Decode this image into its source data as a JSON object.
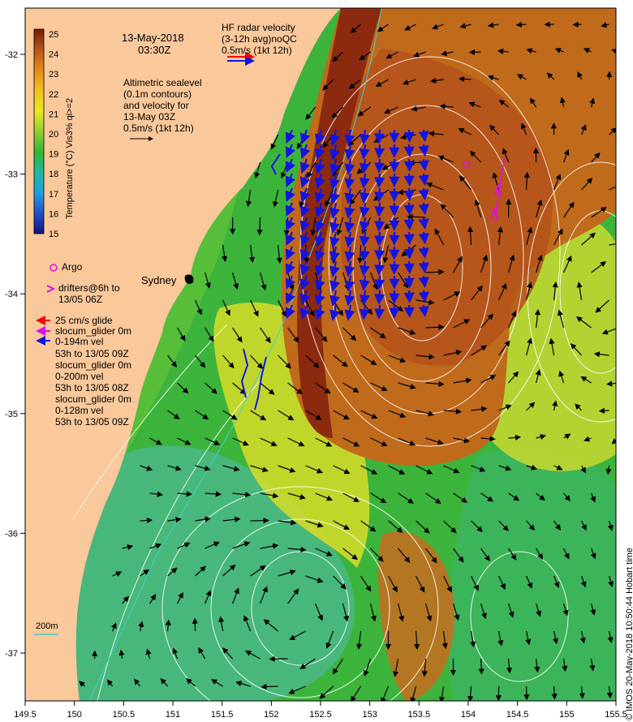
{
  "header": {
    "date": "13-May-2018",
    "time": "03:30Z",
    "hf_title": "HF radar velocity",
    "hf_sub": "(3-12h avg)noQC",
    "hf_scale": "0.5m/s (1kt 12h)"
  },
  "altimetry": {
    "line1": "Altimetric sealevel",
    "line2": "(0.1m contours)",
    "line3": "and velocity for",
    "line4": "13-May 03Z",
    "line5": "0.5m/s (1kt 12h)"
  },
  "colorbar": {
    "label": "Temperature (°C) Vis3% qi>=2",
    "ticks": [
      "25",
      "24",
      "23",
      "22",
      "21",
      "20",
      "19",
      "18",
      "17",
      "16",
      "15"
    ]
  },
  "legend": {
    "argo": "Argo",
    "drifters1": "drifters@6h to",
    "drifters2": "13/05 06Z",
    "glider_scale": "25 cm/s glide",
    "g1_l1": "slocum_glider 0m",
    "g1_l2": "0-194m vel",
    "g1_l3": "53h to 13/05 09Z",
    "g2_l1": "slocum_glider 0m",
    "g2_l2": "0-200m vel",
    "g2_l3": "53h to 13/05 08Z",
    "g3_l1": "slocum_glider 0m",
    "g3_l2": "0-128m vel",
    "g3_l3": "53h to 13/05 09Z",
    "depth": "200m"
  },
  "places": {
    "sydney": "Sydney"
  },
  "axes": {
    "x_ticks": [
      "149.5",
      "150",
      "150.5",
      "151",
      "151.5",
      "152",
      "152.5",
      "153",
      "153.5",
      "154",
      "154.5",
      "155",
      "155.5"
    ],
    "y_ticks": [
      "-32",
      "-33",
      "-34",
      "-35",
      "-36",
      "-37"
    ]
  },
  "credit": "© IMOS 20-May-2018 10:50:44 Hobart time",
  "colors": {
    "land": "#f9c89b",
    "warm": "#b5541c",
    "hot": "#8c2a10",
    "mid": "#e8a020",
    "yellow": "#e8e020",
    "green": "#40b830",
    "cool": "#3cb890",
    "hf_arrow": "#1414e0",
    "argo": "#e010e0",
    "glider_red": "#ff0000"
  }
}
